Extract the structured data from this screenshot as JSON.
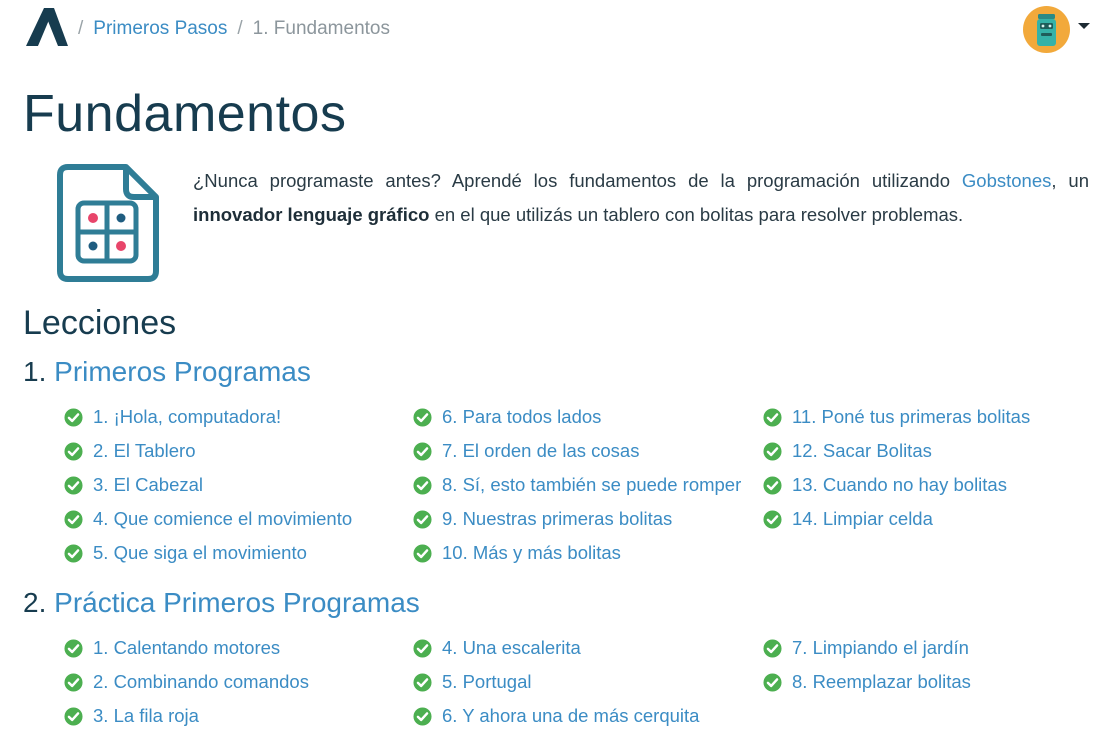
{
  "breadcrumb": {
    "separator": "/",
    "items": [
      {
        "label": "Primeros Pasos",
        "link": true
      },
      {
        "label": "1. Fundamentos",
        "link": false
      }
    ]
  },
  "page": {
    "title": "Fundamentos",
    "intro": {
      "part1": "¿Nunca programaste antes? Aprendé los fundamentos de la programación utilizando ",
      "link": "Gobstones",
      "part2": ", un ",
      "bold": "innovador lenguaje gráfico",
      "part3": " en el que utilizás un tablero con bolitas para resolver problemas."
    },
    "lessons_heading": "Lecciones"
  },
  "colors": {
    "accent": "#3b8cc4",
    "heading": "#173c4f",
    "check": "#4caf50",
    "avatar_bg": "#f2a93b"
  },
  "chapters": [
    {
      "number": "1.",
      "title": "Primeros Programas",
      "columns": [
        [
          "1. ¡Hola, computadora!",
          "2. El Tablero",
          "3. El Cabezal",
          "4. Que comience el movimiento",
          "5. Que siga el movimiento"
        ],
        [
          "6. Para todos lados",
          "7. El orden de las cosas",
          "8. Sí, esto también se puede romper",
          "9. Nuestras primeras bolitas",
          "10. Más y más bolitas"
        ],
        [
          "11. Poné tus primeras bolitas",
          "12. Sacar Bolitas",
          "13. Cuando no hay bolitas",
          "14. Limpiar celda"
        ]
      ]
    },
    {
      "number": "2.",
      "title": "Práctica Primeros Programas",
      "columns": [
        [
          "1. Calentando motores",
          "2. Combinando comandos",
          "3. La fila roja"
        ],
        [
          "4. Una escalerita",
          "5. Portugal",
          "6. Y ahora una de más cerquita"
        ],
        [
          "7. Limpiando el jardín",
          "8. Reemplazar bolitas"
        ]
      ]
    }
  ]
}
